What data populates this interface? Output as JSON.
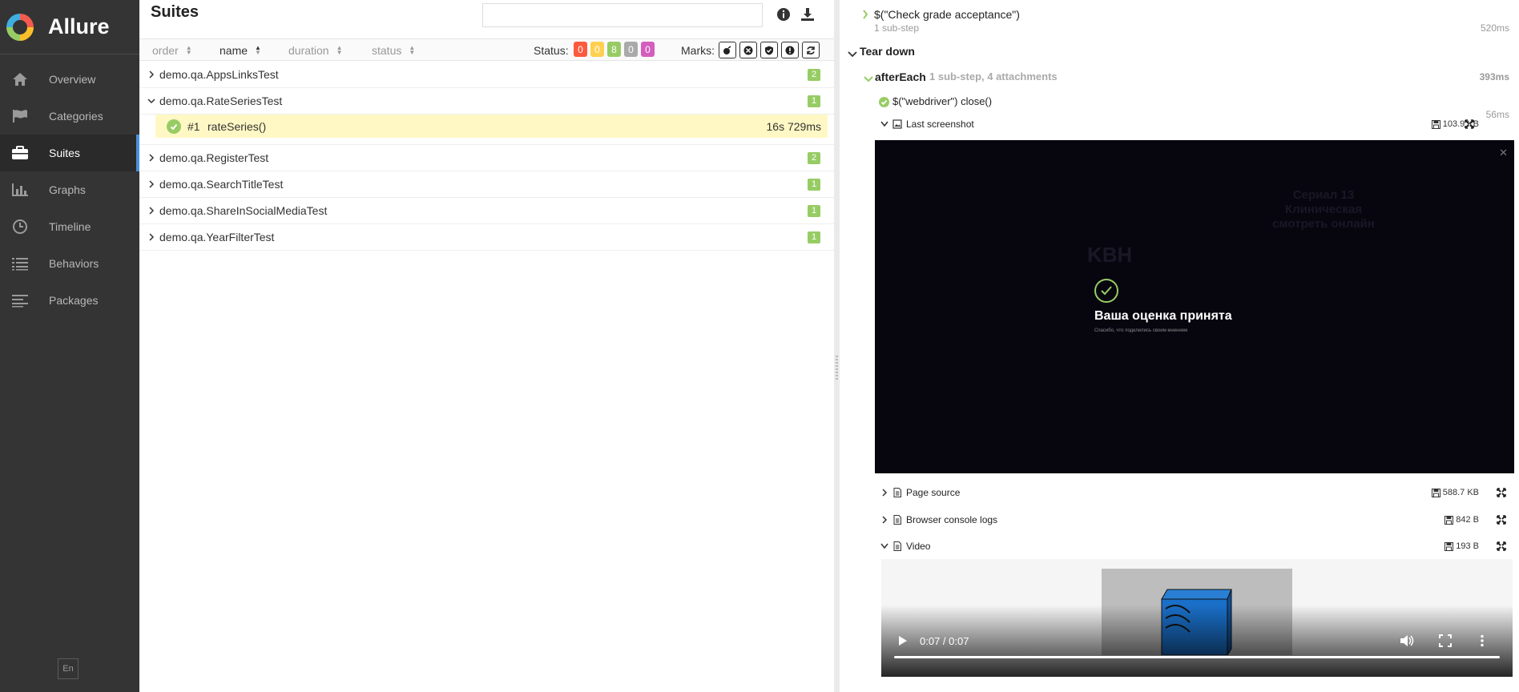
{
  "app": {
    "name": "Allure"
  },
  "sidebar": {
    "items": [
      {
        "label": "Overview",
        "icon": "home-icon"
      },
      {
        "label": "Categories",
        "icon": "flag-icon"
      },
      {
        "label": "Suites",
        "icon": "briefcase-icon",
        "active": true
      },
      {
        "label": "Graphs",
        "icon": "bar-chart-icon"
      },
      {
        "label": "Timeline",
        "icon": "clock-icon"
      },
      {
        "label": "Behaviors",
        "icon": "list-icon"
      },
      {
        "label": "Packages",
        "icon": "align-left-icon"
      }
    ],
    "language": "En"
  },
  "suites": {
    "title": "Suites",
    "search": {
      "value": "",
      "placeholder": ""
    },
    "sort": {
      "order": "order",
      "name": "name",
      "duration": "duration",
      "status": "status"
    },
    "status_label": "Status:",
    "status_counts": [
      {
        "value": "0",
        "color": "#fd5a3e"
      },
      {
        "value": "0",
        "color": "#ffd050"
      },
      {
        "value": "8",
        "color": "#97cc64"
      },
      {
        "value": "0",
        "color": "#aaaaaa"
      },
      {
        "value": "0",
        "color": "#d35ebe"
      }
    ],
    "marks_label": "Marks:",
    "rows": [
      {
        "name": "demo.qa.AppsLinksTest",
        "count": "2",
        "expanded": false
      },
      {
        "name": "demo.qa.RateSeriesTest",
        "count": "1",
        "expanded": true
      },
      {
        "name": "demo.qa.RegisterTest",
        "count": "2",
        "expanded": false
      },
      {
        "name": "demo.qa.SearchTitleTest",
        "count": "1",
        "expanded": false
      },
      {
        "name": "demo.qa.ShareInSocialMediaTest",
        "count": "1",
        "expanded": false
      },
      {
        "name": "demo.qa.YearFilterTest",
        "count": "1",
        "expanded": false
      }
    ],
    "selected_test": {
      "number": "#1",
      "name": "rateSeries()",
      "duration": "16s 729ms"
    }
  },
  "details": {
    "prev_step": {
      "text": "$(\"Check grade acceptance\")",
      "sub": "1 sub-step",
      "time": "520ms"
    },
    "teardown_label": "Tear down",
    "after_each": {
      "name": "afterEach",
      "meta": "1 sub-step, 4 attachments",
      "time": "393ms"
    },
    "close_step": {
      "text": "$(\"webdriver\") close()",
      "time": "56ms"
    },
    "attachments": [
      {
        "name": "Last screenshot",
        "size": "103.9 KB"
      },
      {
        "name": "Page source",
        "size": "588.7 KB"
      },
      {
        "name": "Browser console logs",
        "size": "842 B"
      },
      {
        "name": "Video",
        "size": "193 B"
      }
    ],
    "screenshot": {
      "title": "Ваша оценка принята",
      "subtitle": "Спасибо, что поделились своим мнением",
      "bg_logo": "KBH",
      "bg_heading": "Сериал 13 Клиническая смотреть онлайн"
    },
    "video": {
      "time": "0:07 / 0:07",
      "progress": 1.0
    }
  }
}
